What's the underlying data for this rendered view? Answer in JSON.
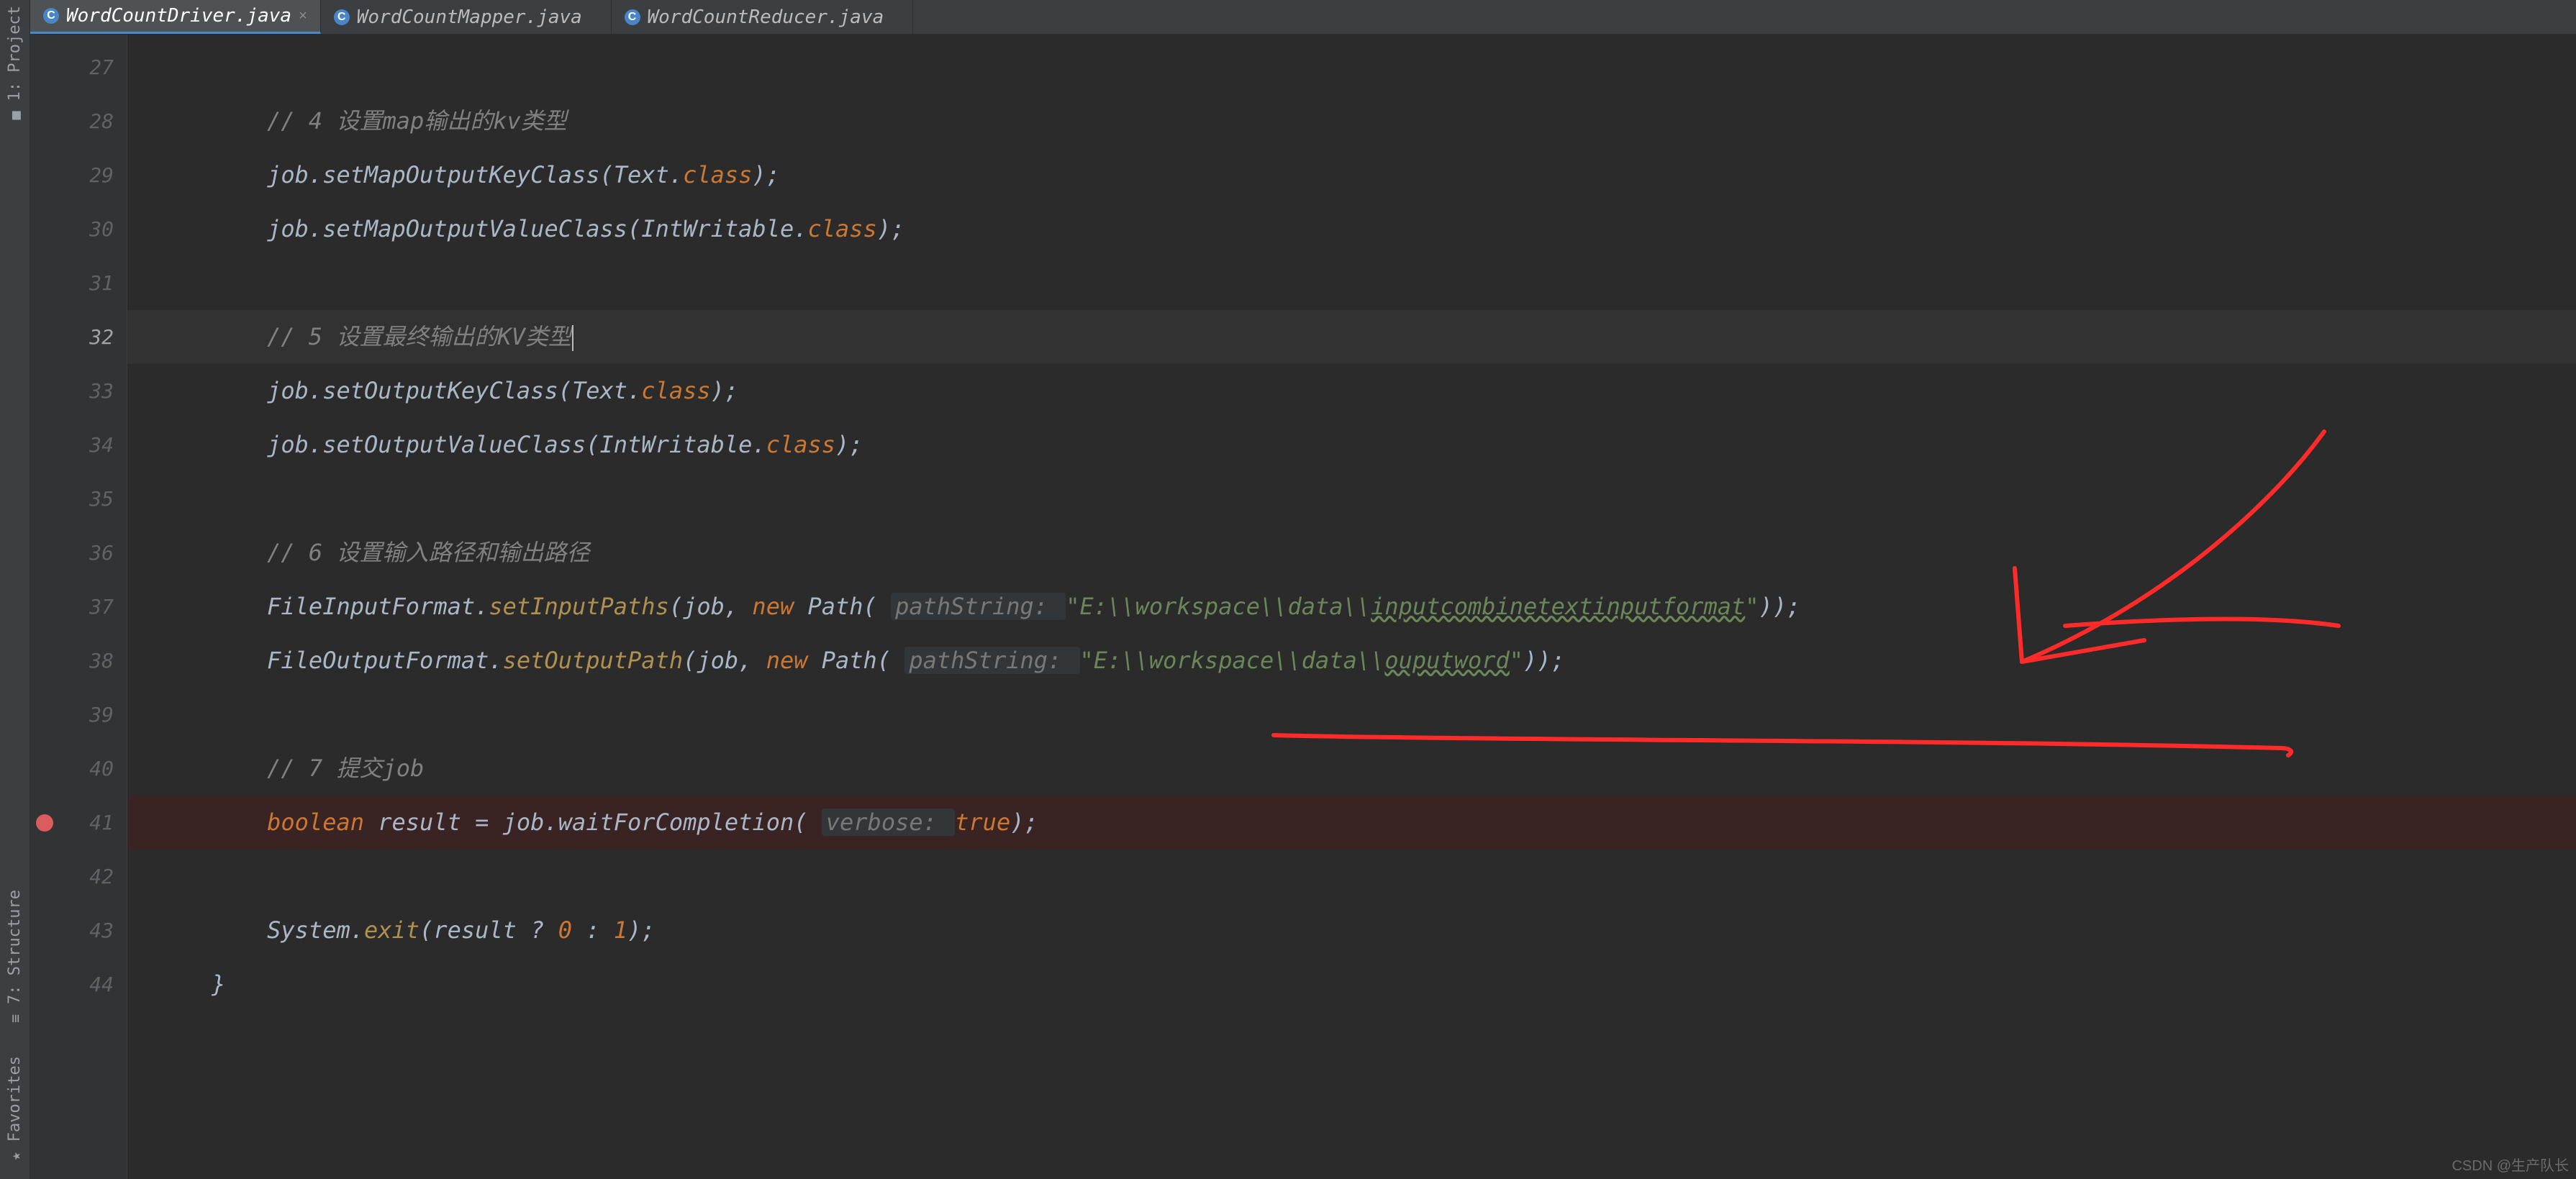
{
  "tool_rail": {
    "items": [
      {
        "label": "1: Project",
        "icon": "■"
      },
      {
        "label": "7: Structure",
        "icon": "≡"
      },
      {
        "label": "Favorites",
        "icon": "★"
      }
    ]
  },
  "tabs": [
    {
      "label": "WordCountDriver.java",
      "icon_letter": "C",
      "active": true
    },
    {
      "label": "WordCountMapper.java",
      "icon_letter": "C",
      "active": false
    },
    {
      "label": "WordCountReducer.java",
      "icon_letter": "C",
      "active": false
    }
  ],
  "editor": {
    "first_line_number": 27,
    "caret_line": 32,
    "breakpoint_line": 41,
    "lines": [
      {
        "n": 27,
        "segs": []
      },
      {
        "n": 28,
        "segs": [
          {
            "t": "        ",
            "c": "p"
          },
          {
            "t": "// 4 设置map输出的kv类型",
            "c": "c-comment"
          }
        ]
      },
      {
        "n": 29,
        "segs": [
          {
            "t": "        job.setMapOutputKeyClass(Text.",
            "c": "p"
          },
          {
            "t": "class",
            "c": "c-key"
          },
          {
            "t": ");",
            "c": "p"
          }
        ]
      },
      {
        "n": 30,
        "segs": [
          {
            "t": "        job.setMapOutputValueClass(IntWritable.",
            "c": "p"
          },
          {
            "t": "class",
            "c": "c-key"
          },
          {
            "t": ");",
            "c": "p"
          }
        ]
      },
      {
        "n": 31,
        "segs": []
      },
      {
        "n": 32,
        "segs": [
          {
            "t": "        ",
            "c": "p"
          },
          {
            "t": "// 5 设置最终输出的KV类型",
            "c": "c-comment"
          },
          {
            "t": "",
            "c": "caret"
          }
        ]
      },
      {
        "n": 33,
        "segs": [
          {
            "t": "        job.setOutputKeyClass(Text.",
            "c": "p"
          },
          {
            "t": "class",
            "c": "c-key"
          },
          {
            "t": ");",
            "c": "p"
          }
        ]
      },
      {
        "n": 34,
        "segs": [
          {
            "t": "        job.setOutputValueClass(IntWritable.",
            "c": "p"
          },
          {
            "t": "class",
            "c": "c-key"
          },
          {
            "t": ");",
            "c": "p"
          }
        ]
      },
      {
        "n": 35,
        "segs": []
      },
      {
        "n": 36,
        "segs": [
          {
            "t": "        ",
            "c": "p"
          },
          {
            "t": "// 6 设置输入路径和输出路径",
            "c": "c-comment"
          }
        ]
      },
      {
        "n": 37,
        "segs": [
          {
            "t": "        FileInputFormat.",
            "c": "p"
          },
          {
            "t": "setInputPaths",
            "c": "c-static"
          },
          {
            "t": "(job, ",
            "c": "p"
          },
          {
            "t": "new ",
            "c": "c-key"
          },
          {
            "t": "Path( ",
            "c": "p"
          },
          {
            "t": "pathString: ",
            "c": "c-hint"
          },
          {
            "t": "\"E:\\\\workspace\\\\data\\\\",
            "c": "c-str"
          },
          {
            "t": "inputcombinetextinputformat",
            "c": "c-str c-warn"
          },
          {
            "t": "\"",
            "c": "c-str"
          },
          {
            "t": "));",
            "c": "p"
          }
        ]
      },
      {
        "n": 38,
        "segs": [
          {
            "t": "        FileOutputFormat.",
            "c": "p"
          },
          {
            "t": "setOutputPath",
            "c": "c-static"
          },
          {
            "t": "(job, ",
            "c": "p"
          },
          {
            "t": "new ",
            "c": "c-key"
          },
          {
            "t": "Path( ",
            "c": "p"
          },
          {
            "t": "pathString: ",
            "c": "c-hint"
          },
          {
            "t": "\"E:\\\\workspace\\\\data\\\\",
            "c": "c-str"
          },
          {
            "t": "ouputword",
            "c": "c-str c-warn"
          },
          {
            "t": "\"",
            "c": "c-str"
          },
          {
            "t": "));",
            "c": "p"
          }
        ]
      },
      {
        "n": 39,
        "segs": []
      },
      {
        "n": 40,
        "segs": [
          {
            "t": "        ",
            "c": "p"
          },
          {
            "t": "// 7 提交job",
            "c": "c-comment"
          }
        ]
      },
      {
        "n": 41,
        "segs": [
          {
            "t": "        ",
            "c": "p"
          },
          {
            "t": "boolean ",
            "c": "c-key"
          },
          {
            "t": "result = job.waitForCompletion( ",
            "c": "p"
          },
          {
            "t": "verbose: ",
            "c": "c-hint"
          },
          {
            "t": "true",
            "c": "c-key"
          },
          {
            "t": ");",
            "c": "p"
          }
        ]
      },
      {
        "n": 42,
        "segs": []
      },
      {
        "n": 43,
        "segs": [
          {
            "t": "        System.",
            "c": "p"
          },
          {
            "t": "exit",
            "c": "c-static"
          },
          {
            "t": "(result ? ",
            "c": "p"
          },
          {
            "t": "0",
            "c": "c-key"
          },
          {
            "t": " : ",
            "c": "p"
          },
          {
            "t": "1",
            "c": "c-key"
          },
          {
            "t": ");",
            "c": "p"
          }
        ]
      },
      {
        "n": 44,
        "segs": [
          {
            "t": "    }",
            "c": "p"
          }
        ]
      }
    ]
  },
  "annotation": {
    "stroke": "#ff2a2a",
    "width": 6
  },
  "watermark": "CSDN @生产队长"
}
